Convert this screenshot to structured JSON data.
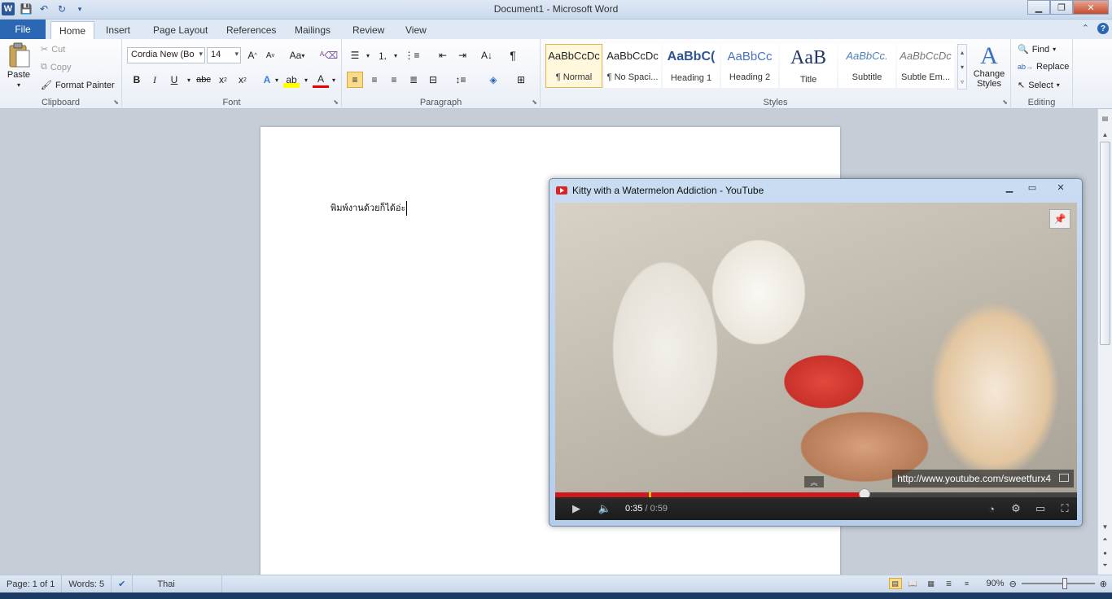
{
  "window": {
    "title": "Document1  -  Microsoft Word"
  },
  "ribbon_tabs": {
    "file": "File",
    "home": "Home",
    "insert": "Insert",
    "page_layout": "Page Layout",
    "references": "References",
    "mailings": "Mailings",
    "review": "Review",
    "view": "View"
  },
  "clipboard": {
    "paste": "Paste",
    "cut": "Cut",
    "copy": "Copy",
    "format_painter": "Format Painter",
    "label": "Clipboard"
  },
  "font": {
    "family": "Cordia New (Bo",
    "size": "14",
    "label": "Font",
    "case": "Aa"
  },
  "paragraph": {
    "label": "Paragraph"
  },
  "styles": {
    "label": "Styles",
    "items": [
      {
        "sample": "AaBbCcDc",
        "name": "¶ Normal"
      },
      {
        "sample": "AaBbCcDc",
        "name": "¶ No Spaci..."
      },
      {
        "sample": "AaBbC(",
        "name": "Heading 1"
      },
      {
        "sample": "AaBbCc",
        "name": "Heading 2"
      },
      {
        "sample": "AaB",
        "name": "Title"
      },
      {
        "sample": "AaBbCc.",
        "name": "Subtitle"
      },
      {
        "sample": "AaBbCcDc",
        "name": "Subtle Em..."
      }
    ],
    "change_styles": "Change Styles"
  },
  "editing": {
    "label": "Editing",
    "find": "Find",
    "replace": "Replace",
    "select": "Select"
  },
  "document": {
    "text": "พิมพ์งานด้วยก็ได้อ่ะ"
  },
  "status": {
    "page": "Page: 1 of 1",
    "words": "Words: 5",
    "language": "Thai",
    "zoom": "90%"
  },
  "youtube": {
    "title": "Kitty with a Watermelon Addiction - YouTube",
    "url_overlay": "http://www.youtube.com/sweetfurx4",
    "current_time": "0:35",
    "duration": "/ 0:59",
    "progress_fraction": 0.593
  },
  "colors": {
    "accent": "#2b579a",
    "progress": "#cc181e"
  }
}
